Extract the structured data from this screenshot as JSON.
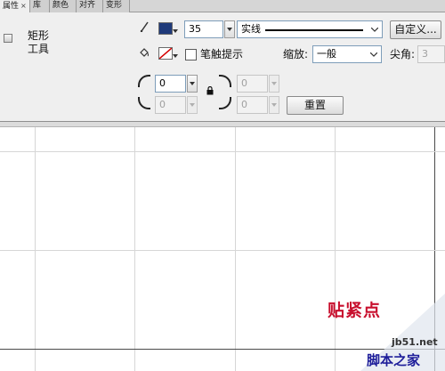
{
  "tabs": [
    {
      "label": "属性",
      "close": "×",
      "active": true
    },
    {
      "label": "库",
      "active": false
    },
    {
      "label": "颜色",
      "active": false
    },
    {
      "label": "对齐",
      "active": false
    },
    {
      "label": "变形",
      "active": false
    }
  ],
  "tool": {
    "name": "矩形\n工具",
    "icon": "rectangle-tool-icon"
  },
  "stroke": {
    "pencil_icon": "pencil-icon",
    "color": "#1f3a7a",
    "width": "35",
    "style": "实线",
    "custom_button": "自定义..."
  },
  "fill": {
    "bucket_icon": "paint-bucket-icon",
    "color": "none",
    "hinting_label": "笔触提示",
    "scale_label": "缩放:",
    "scale_value": "一般",
    "miter_label": "尖角:",
    "miter_value": "3"
  },
  "corners": {
    "top_left_value": "0",
    "bottom_left_value": "0",
    "top_right_value": "0",
    "bottom_right_value": "0",
    "lock_icon": "lock-icon",
    "reset_button": "重置"
  },
  "stage": {
    "snap_label": "贴紧点"
  },
  "watermark": {
    "site": "jb51.net",
    "name": "脚本之家"
  }
}
